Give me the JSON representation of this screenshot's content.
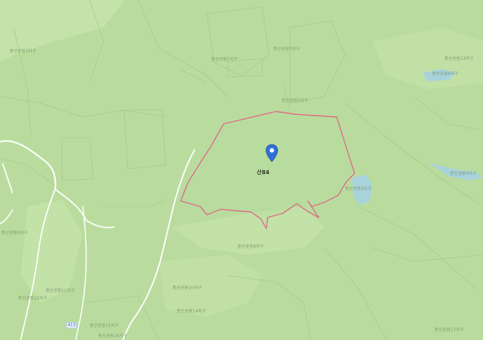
{
  "map": {
    "parcel_label": "산84",
    "road_number": "413",
    "labels": {
      "l1": "봉산공원3지구",
      "l2": "봉산공원7지구",
      "l3": "봉산공원1지구",
      "l4": "봉산공원13지구",
      "l5": "봉산공원6지구",
      "l6": "봉산공원5지구",
      "l7": "봉산공원4지구",
      "l8": "봉산공원2지구",
      "l9": "봉산공원9지구",
      "l10": "봉산공원8지구",
      "l11": "봉산공원10지구",
      "l12": "봉산공원11지구",
      "l13": "봉산공원12지구",
      "l14": "봉산공원14지구",
      "l15": "봉산공원15지구",
      "l16": "봉산공원16지구",
      "l17": "봉산공원17지구"
    }
  },
  "colors": {
    "background": "#b9dc9e",
    "parcel_outline": "#e0688a",
    "road": "#ffffff",
    "water": "#a9d3db",
    "pin": "#2f6fd6"
  }
}
